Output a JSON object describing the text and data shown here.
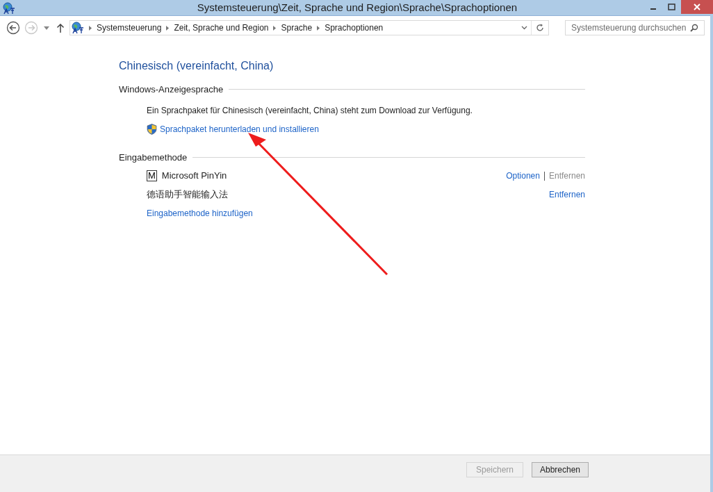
{
  "window": {
    "title": "Systemsteuerung\\Zeit, Sprache und Region\\Sprache\\Sprachoptionen"
  },
  "navigation": {
    "back_disabled": false,
    "forward_disabled": true
  },
  "breadcrumb": [
    "Systemsteuerung",
    "Zeit, Sprache und Region",
    "Sprache",
    "Sprachoptionen"
  ],
  "search": {
    "placeholder": "Systemsteuerung durchsuchen"
  },
  "heading": "Chinesisch (vereinfacht, China)",
  "display_language": {
    "title": "Windows-Anzeigesprache",
    "message": "Ein Sprachpaket für Chinesisch (vereinfacht, China) steht zum Download zur Verfügung.",
    "link": "Sprachpaket herunterladen und installieren"
  },
  "input_methods": {
    "title": "Eingabemethode",
    "items": [
      {
        "name": "Microsoft PinYin",
        "badge": "M",
        "actions": [
          {
            "label": "Optionen",
            "disabled": false
          },
          {
            "label": "Entfernen",
            "disabled": true
          }
        ]
      },
      {
        "name": "德语助手智能输入法",
        "actions": [
          {
            "label": "Entfernen",
            "disabled": false
          }
        ]
      }
    ],
    "add_link": "Eingabemethode hinzufügen"
  },
  "buttons": [
    {
      "label": "Speichern",
      "disabled": true
    },
    {
      "label": "Abbrechen",
      "disabled": false
    }
  ]
}
